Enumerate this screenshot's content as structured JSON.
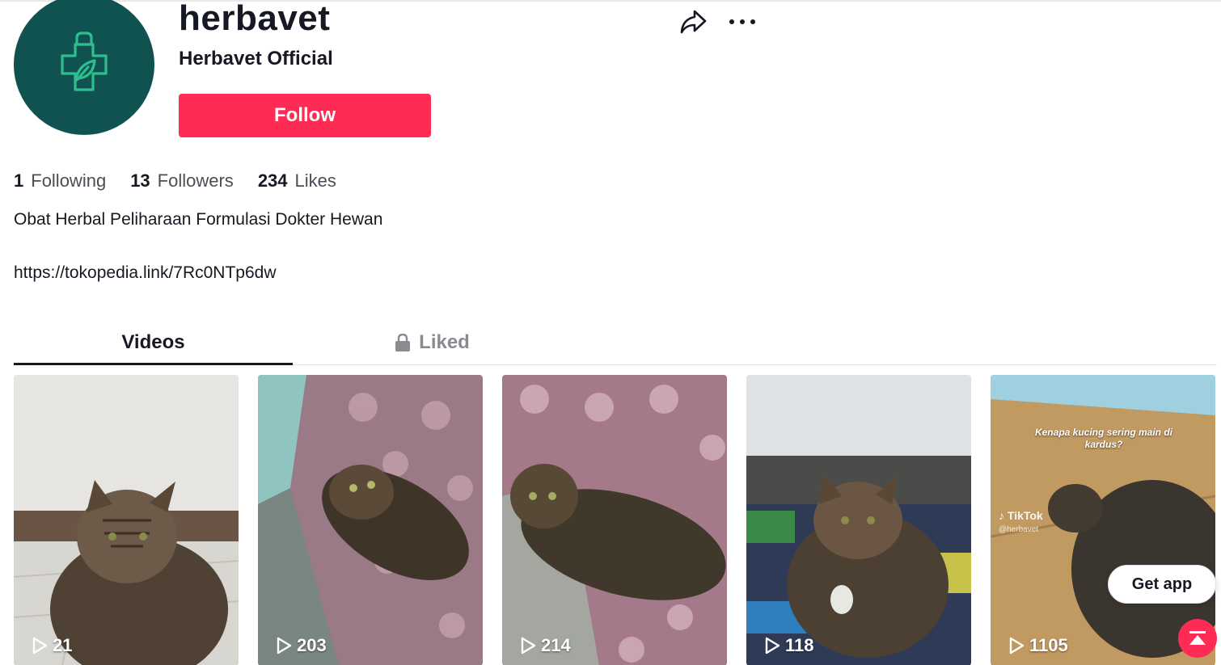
{
  "profile": {
    "username": "herbavet",
    "display_name": "Herbavet Official",
    "follow_label": "Follow",
    "avatar_bg": "#0f5250",
    "avatar_icon_color": "#2fbf8f"
  },
  "stats": [
    {
      "count": "1",
      "label": "Following"
    },
    {
      "count": "13",
      "label": "Followers"
    },
    {
      "count": "234",
      "label": "Likes"
    }
  ],
  "bio": {
    "text": "Obat Herbal Peliharaan Formulasi Dokter Hewan",
    "link": "https://tokopedia.link/7Rc0NTp6dw"
  },
  "tabs": [
    {
      "label": "Videos",
      "active": true
    },
    {
      "label": "Liked",
      "locked": true
    }
  ],
  "videos": [
    {
      "views": "21"
    },
    {
      "views": "203"
    },
    {
      "views": "214"
    },
    {
      "views": "118"
    },
    {
      "views": "1105",
      "caption": "Kenapa kucing sering main di kardus?",
      "watermark": "TikTok",
      "handle": "@herbavet"
    }
  ],
  "get_app_label": "Get app",
  "icons": {
    "share": "share-icon",
    "more": "more-icon",
    "lock": "lock-icon",
    "play": "play-icon",
    "scroll_top": "arrow-up-icon"
  },
  "colors": {
    "accent": "#fe2c55",
    "text": "#161823",
    "muted": "#8a8b91"
  }
}
